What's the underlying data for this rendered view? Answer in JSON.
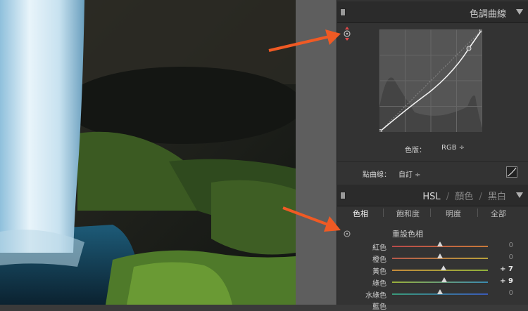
{
  "panel": {
    "tone_curve": {
      "title": "色調曲線",
      "channel_label": "色版：",
      "channel_value": "RGB ÷",
      "point_curve_label": "點曲線：",
      "point_curve_value": "自訂 ÷"
    },
    "hsl": {
      "title_parts": [
        "HSL",
        "/",
        "顏色",
        "/",
        "黑白"
      ],
      "tabs": [
        "色相",
        "飽和度",
        "明度",
        "全部"
      ],
      "active_tab": "色相",
      "section_title": "重設色相",
      "sliders": [
        {
          "label": "紅色",
          "value": "0",
          "level": 0.5,
          "colors": [
            "#b84a4a",
            "#c97a3a"
          ]
        },
        {
          "label": "橙色",
          "value": "0",
          "level": 0.5,
          "colors": [
            "#b8584a",
            "#b9a23a"
          ]
        },
        {
          "label": "黃色",
          "value": "+ 7",
          "level": 0.535,
          "colors": [
            "#c78a3a",
            "#8fb23a"
          ]
        },
        {
          "label": "綠色",
          "value": "+ 9",
          "level": 0.545,
          "colors": [
            "#9ab03a",
            "#3a8ab0"
          ]
        },
        {
          "label": "水綠色",
          "value": "0",
          "level": 0.5,
          "colors": [
            "#3a9a7a",
            "#3a5ab8"
          ]
        }
      ],
      "partial_label": "藍色"
    }
  },
  "colors": {
    "arrow": "#f05a24",
    "panel_bg": "#333333",
    "header_bg": "#2b2b2b"
  }
}
